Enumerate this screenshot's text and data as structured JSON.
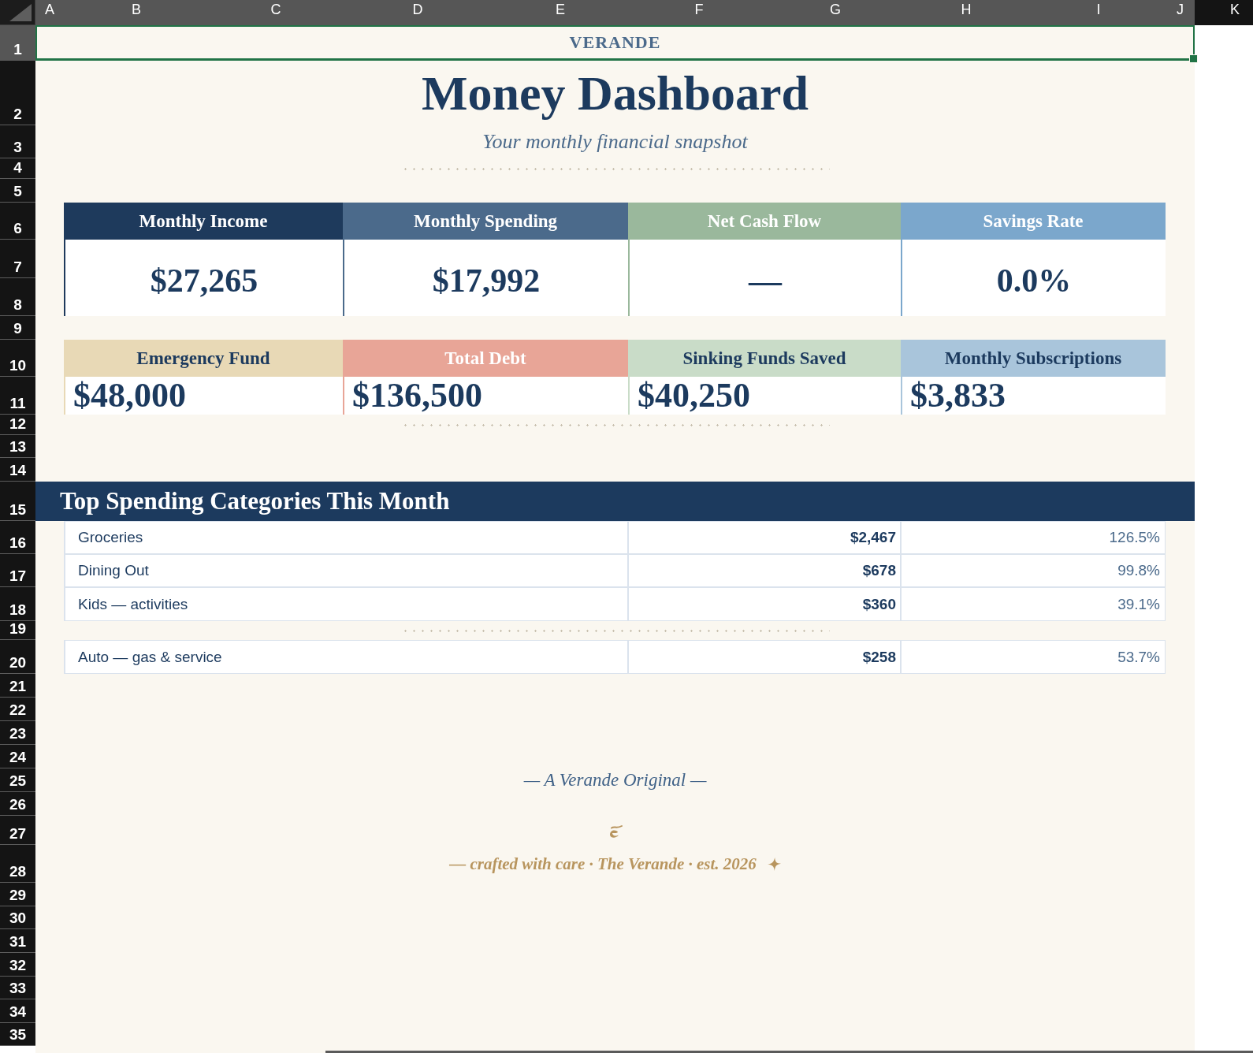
{
  "sheet": {
    "columns": [
      {
        "label": "A",
        "selected": true
      },
      {
        "label": "B",
        "selected": true
      },
      {
        "label": "C",
        "selected": true
      },
      {
        "label": "D",
        "selected": true
      },
      {
        "label": "E",
        "selected": true
      },
      {
        "label": "F",
        "selected": true
      },
      {
        "label": "G",
        "selected": true
      },
      {
        "label": "H",
        "selected": true
      },
      {
        "label": "I",
        "selected": true
      },
      {
        "label": "J",
        "selected": true
      },
      {
        "label": "K",
        "selected": false
      }
    ],
    "rows": [
      {
        "label": "1",
        "selected": true
      },
      {
        "label": "2",
        "selected": false
      },
      {
        "label": "3",
        "selected": false
      },
      {
        "label": "4",
        "selected": false
      },
      {
        "label": "5",
        "selected": false
      },
      {
        "label": "6",
        "selected": false
      },
      {
        "label": "7",
        "selected": false
      },
      {
        "label": "8",
        "selected": false
      },
      {
        "label": "9",
        "selected": false
      },
      {
        "label": "10",
        "selected": false
      },
      {
        "label": "11",
        "selected": false
      },
      {
        "label": "12",
        "selected": false
      },
      {
        "label": "13",
        "selected": false
      },
      {
        "label": "14",
        "selected": false
      },
      {
        "label": "15",
        "selected": false
      },
      {
        "label": "16",
        "selected": false
      },
      {
        "label": "17",
        "selected": false
      },
      {
        "label": "18",
        "selected": false
      },
      {
        "label": "19",
        "selected": false
      },
      {
        "label": "20",
        "selected": false
      },
      {
        "label": "21",
        "selected": false
      },
      {
        "label": "22",
        "selected": false
      },
      {
        "label": "23",
        "selected": false
      },
      {
        "label": "24",
        "selected": false
      },
      {
        "label": "25",
        "selected": false
      },
      {
        "label": "26",
        "selected": false
      },
      {
        "label": "27",
        "selected": false
      },
      {
        "label": "28",
        "selected": false
      },
      {
        "label": "29",
        "selected": false
      },
      {
        "label": "30",
        "selected": false
      },
      {
        "label": "31",
        "selected": false
      },
      {
        "label": "32",
        "selected": false
      },
      {
        "label": "33",
        "selected": false
      },
      {
        "label": "34",
        "selected": false
      },
      {
        "label": "35",
        "selected": false
      }
    ]
  },
  "brand_cell": {
    "text": "VERANDE",
    "selected": true
  },
  "title": "Money Dashboard",
  "subtitle": "Your monthly financial snapshot",
  "summary_cards": [
    {
      "label": "Monthly Income",
      "value": "$27,265",
      "color": "#1e3a5c"
    },
    {
      "label": "Monthly Spending",
      "value": "$17,992",
      "color": "#4b6a8b"
    },
    {
      "label": "Net Cash Flow",
      "value": "—",
      "color": "#9ab89c"
    },
    {
      "label": "Savings Rate",
      "value": "0.0%",
      "color": "#7ba7cc"
    }
  ],
  "balance_cards": [
    {
      "label": "Emergency Fund",
      "value": "$48,000",
      "color": "#e8d9b6"
    },
    {
      "label": "Total Debt",
      "value": "$136,500",
      "color": "#e8a597"
    },
    {
      "label": "Sinking Funds Saved",
      "value": "$40,250",
      "color": "#c9dcc8"
    },
    {
      "label": "Monthly Subscriptions",
      "value": "$3,833",
      "color": "#a9c5db"
    }
  ],
  "spending": {
    "title": "Top Spending Categories This Month",
    "rows": [
      {
        "category": "Groceries",
        "amount": "$2,467",
        "percent": "126.5%"
      },
      {
        "category": "Dining Out",
        "amount": "$678",
        "percent": "99.8%"
      },
      {
        "category": "Kids — activities",
        "amount": "$360",
        "percent": "39.1%"
      },
      {
        "category": "Auto — gas & service",
        "amount": "$258",
        "percent": "53.7%"
      }
    ]
  },
  "footer": {
    "signature": "— A Verande Original —",
    "credit": "— crafted with care · The Verande · est. 2026"
  }
}
